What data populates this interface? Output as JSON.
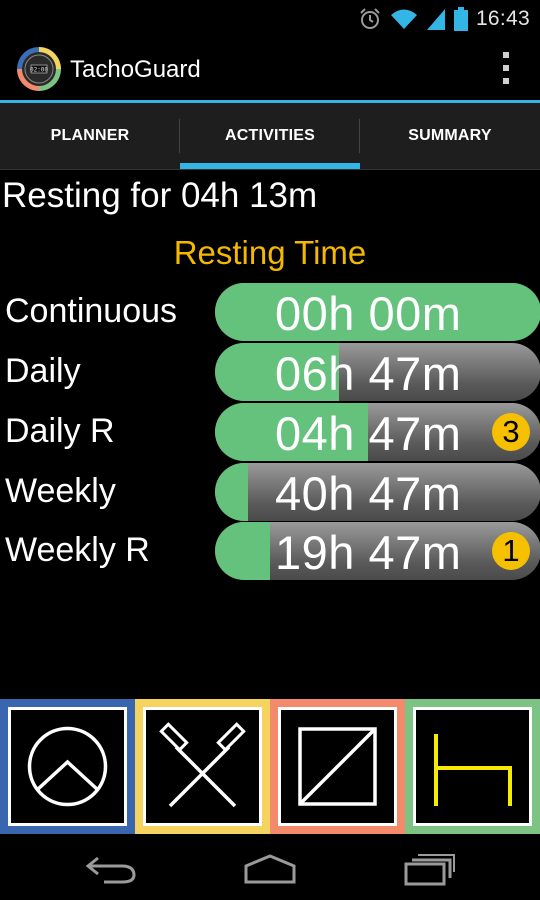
{
  "status_bar": {
    "time": "16:43",
    "icons": [
      "alarm-icon",
      "wifi-icon",
      "signal-icon",
      "battery-icon"
    ]
  },
  "action_bar": {
    "app_title": "TachoGuard",
    "logo_icon": "tachograph-clock-icon",
    "overflow_icon": "overflow-menu-icon"
  },
  "tabs": [
    {
      "label": "PLANNER",
      "active": false
    },
    {
      "label": "ACTIVITIES",
      "active": true
    },
    {
      "label": "SUMMARY",
      "active": false
    }
  ],
  "current_status": "Resting for 04h 13m",
  "section_title": "Resting Time",
  "rest_rows": [
    {
      "label": "Continuous",
      "value": "00h 00m",
      "fill_fraction": 1.0,
      "badge": ""
    },
    {
      "label": "Daily",
      "value": "06h 47m",
      "fill_fraction": 0.38,
      "badge": ""
    },
    {
      "label": "Daily R",
      "value": "04h 47m",
      "fill_fraction": 0.47,
      "badge": "3"
    },
    {
      "label": "Weekly",
      "value": "40h 47m",
      "fill_fraction": 0.1,
      "badge": ""
    },
    {
      "label": "Weekly R",
      "value": "19h 47m",
      "fill_fraction": 0.17,
      "badge": "1"
    }
  ],
  "activity_buttons": [
    {
      "name": "available-button",
      "icon": "availability-icon",
      "color": "#3a66b0",
      "symbol_color": "#ffffff"
    },
    {
      "name": "work-button",
      "icon": "crossed-hammers-icon",
      "color": "#f4d35e",
      "symbol_color": "#ffffff"
    },
    {
      "name": "driving-button",
      "icon": "driving-icon",
      "color": "#f28a6b",
      "symbol_color": "#ffffff"
    },
    {
      "name": "rest-button",
      "icon": "bed-icon",
      "color": "#7dc383",
      "symbol_color": "#f7ec00"
    }
  ],
  "colors": {
    "accent": "#33b5e5",
    "section_title": "#f5b800",
    "fill_green": "#64c27c",
    "badge": "#f5c000"
  },
  "nav_bar": {
    "icons": [
      "back-icon",
      "home-icon",
      "recent-apps-icon"
    ]
  }
}
